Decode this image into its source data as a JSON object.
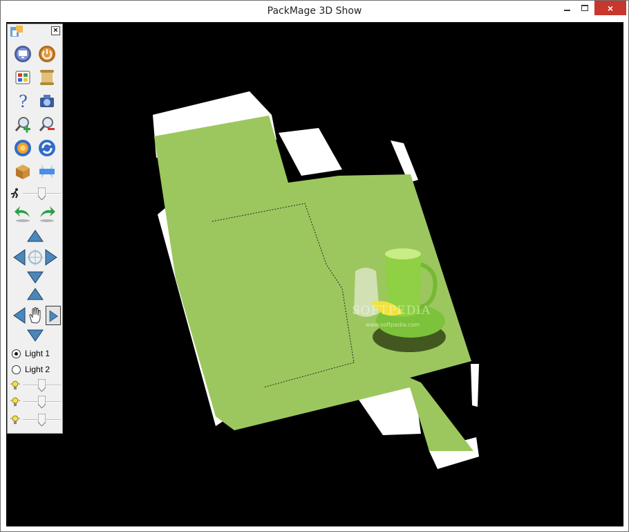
{
  "window": {
    "title": "PackMage 3D Show",
    "controls": {
      "minimize": "minimize-icon",
      "maximize": "maximize-icon",
      "close": "×"
    }
  },
  "toolbox": {
    "close": "×",
    "tools": [
      {
        "name": "display-tool-icon",
        "kind": "monitor"
      },
      {
        "name": "power-tool-icon",
        "kind": "power"
      },
      {
        "name": "palette-tool-icon",
        "kind": "palette"
      },
      {
        "name": "scroll-tool-icon",
        "kind": "scroll"
      },
      {
        "name": "help-tool-icon",
        "kind": "help"
      },
      {
        "name": "camera-tool-icon",
        "kind": "camera"
      },
      {
        "name": "zoom-in-tool-icon",
        "kind": "zoom-in"
      },
      {
        "name": "zoom-out-tool-icon",
        "kind": "zoom-out"
      },
      {
        "name": "fit-tool-icon",
        "kind": "globe"
      },
      {
        "name": "refresh-tool-icon",
        "kind": "refresh"
      },
      {
        "name": "box-tool-icon",
        "kind": "box"
      },
      {
        "name": "unfold-tool-icon",
        "kind": "unfold"
      }
    ],
    "speed_slider": {
      "icon": "runner-icon",
      "value": 0.5
    },
    "rotate_buttons": [
      "rotate-left-icon",
      "rotate-right-icon"
    ],
    "move_pad": [
      "move-up-icon",
      "move-left-icon",
      "move-center-icon",
      "move-right-icon",
      "move-down-icon"
    ],
    "pan_pad": [
      "pan-up-icon",
      "pan-left-icon",
      "hand-icon",
      "pan-right-icon",
      "pan-down-icon"
    ],
    "lights": [
      {
        "label": "Light 1",
        "selected": true
      },
      {
        "label": "Light 2",
        "selected": false
      }
    ],
    "light_sliders": [
      {
        "icon": "bulb-icon",
        "value": 0.5
      },
      {
        "icon": "bulb-icon",
        "value": 0.5
      },
      {
        "icon": "bulb-icon",
        "value": 0.5
      }
    ]
  },
  "viewport": {
    "background": "#000000",
    "box_color": "#9cc75e",
    "flap_color": "#ffffff",
    "watermark": "SOFTPEDIA",
    "watermark_url": "www.softpedia.com"
  }
}
